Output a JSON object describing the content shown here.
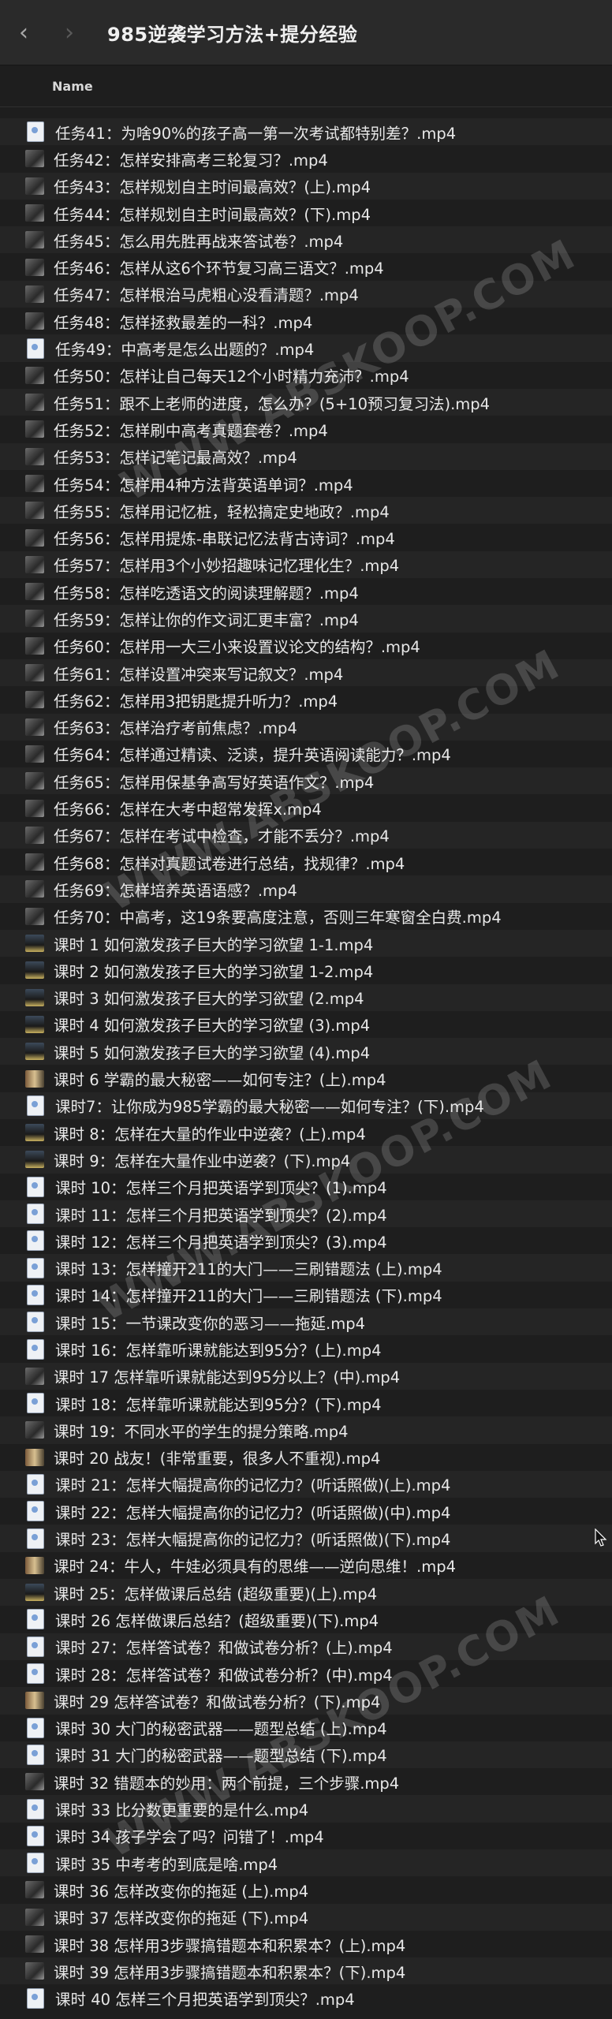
{
  "window": {
    "back_icon": "chevron-left-icon",
    "forward_icon": "chevron-right-icon",
    "title": "985逆袭学习方法+提分经验"
  },
  "list": {
    "column_header": "Name",
    "files": [
      {
        "name": "任务41：为啥90%的孩子高一第一次考试都特别差？.mp4",
        "thumb": "doc"
      },
      {
        "name": "任务42：怎样安排高考三轮复习？.mp4",
        "thumb": "img"
      },
      {
        "name": "任务43：怎样规划自主时间最高效？(上).mp4",
        "thumb": "img"
      },
      {
        "name": "任务44：怎样规划自主时间最高效？(下).mp4",
        "thumb": "img"
      },
      {
        "name": "任务45：怎么用先胜再战来答试卷？.mp4",
        "thumb": "img"
      },
      {
        "name": "任务46：怎样从这6个环节复习高三语文？.mp4",
        "thumb": "img"
      },
      {
        "name": "任务47：怎样根治马虎粗心没看清题？.mp4",
        "thumb": "img"
      },
      {
        "name": "任务48：怎样拯救最差的一科？.mp4",
        "thumb": "img"
      },
      {
        "name": "任务49：中高考是怎么出题的？.mp4",
        "thumb": "doc"
      },
      {
        "name": "任务50：怎样让自己每天12个小时精力充沛？.mp4",
        "thumb": "img"
      },
      {
        "name": "任务51：跟不上老师的进度，怎么办？(5+10预习复习法).mp4",
        "thumb": "img"
      },
      {
        "name": "任务52：怎样刷中高考真题套卷？.mp4",
        "thumb": "img"
      },
      {
        "name": "任务53：怎样记笔记最高效？.mp4",
        "thumb": "img"
      },
      {
        "name": "任务54：怎样用4种方法背英语单词？.mp4",
        "thumb": "img"
      },
      {
        "name": "任务55：怎样用记忆桩，轻松搞定史地政？.mp4",
        "thumb": "img"
      },
      {
        "name": "任务56：怎样用提炼-串联记忆法背古诗词？.mp4",
        "thumb": "img"
      },
      {
        "name": "任务57：怎样用3个小妙招趣味记忆理化生？.mp4",
        "thumb": "img"
      },
      {
        "name": "任务58：怎样吃透语文的阅读理解题？.mp4",
        "thumb": "img"
      },
      {
        "name": "任务59：怎样让你的作文词汇更丰富？.mp4",
        "thumb": "img"
      },
      {
        "name": "任务60：怎样用一大三小来设置议论文的结构？.mp4",
        "thumb": "img"
      },
      {
        "name": "任务61：怎样设置冲突来写记叙文？.mp4",
        "thumb": "img"
      },
      {
        "name": "任务62：怎样用3把钥匙提升听力？.mp4",
        "thumb": "img"
      },
      {
        "name": "任务63：怎样治疗考前焦虑？.mp4",
        "thumb": "img"
      },
      {
        "name": "任务64：怎样通过精读、泛读，提升英语阅读能力？.mp4",
        "thumb": "img"
      },
      {
        "name": "任务65：怎样用保基争高写好英语作文？.mp4",
        "thumb": "img"
      },
      {
        "name": "任务66：怎样在大考中超常发挥x.mp4",
        "thumb": "img"
      },
      {
        "name": "任务67：怎样在考试中检查，才能不丢分？.mp4",
        "thumb": "img"
      },
      {
        "name": "任务68：怎样对真题试卷进行总结，找规律？.mp4",
        "thumb": "img"
      },
      {
        "name": "任务69：怎样培养英语语感？.mp4",
        "thumb": "img"
      },
      {
        "name": "任务70：中高考，这19条要高度注意，否则三年寒窗全白费.mp4",
        "thumb": "img"
      },
      {
        "name": "课时 1 如何激发孩子巨大的学习欲望 1-1.mp4",
        "thumb": "img2"
      },
      {
        "name": "课时 2 如何激发孩子巨大的学习欲望 1-2.mp4",
        "thumb": "img2"
      },
      {
        "name": "课时 3 如何激发孩子巨大的学习欲望 (2.mp4",
        "thumb": "img2"
      },
      {
        "name": "课时 4 如何激发孩子巨大的学习欲望 (3).mp4",
        "thumb": "img2"
      },
      {
        "name": "课时 5 如何激发孩子巨大的学习欲望 (4).mp4",
        "thumb": "img2"
      },
      {
        "name": "课时 6 学霸的最大秘密——如何专注？(上).mp4",
        "thumb": "img3"
      },
      {
        "name": "课时7：让你成为985学霸的最大秘密——如何专注？(下).mp4",
        "thumb": "doc"
      },
      {
        "name": "课时 8：怎样在大量的作业中逆袭？(上).mp4",
        "thumb": "img2"
      },
      {
        "name": "课时 9：怎样在大量作业中逆袭？(下).mp4",
        "thumb": "img2"
      },
      {
        "name": "课时 10：怎样三个月把英语学到顶尖？(1).mp4",
        "thumb": "doc"
      },
      {
        "name": "课时 11：怎样三个月把英语学到顶尖？(2).mp4",
        "thumb": "doc"
      },
      {
        "name": "课时 12：怎样三个月把英语学到顶尖？(3).mp4",
        "thumb": "doc"
      },
      {
        "name": "课时 13：怎样撞开211的大门——三刷错题法 (上).mp4",
        "thumb": "doc"
      },
      {
        "name": "课时 14：怎样撞开211的大门——三刷错题法 (下).mp4",
        "thumb": "doc"
      },
      {
        "name": "课时 15：一节课改变你的恶习——拖延.mp4",
        "thumb": "doc"
      },
      {
        "name": "课时 16：怎样靠听课就能达到95分？(上).mp4",
        "thumb": "doc"
      },
      {
        "name": "课时 17 怎样靠听课就能达到95分以上？(中).mp4",
        "thumb": "img"
      },
      {
        "name": "课时 18：怎样靠听课就能达到95分？(下).mp4",
        "thumb": "doc"
      },
      {
        "name": "课时 19：不同水平的学生的提分策略.mp4",
        "thumb": "img"
      },
      {
        "name": "课时 20 战友！(非常重要，很多人不重视).mp4",
        "thumb": "img3"
      },
      {
        "name": "课时 21：怎样大幅提高你的记忆力？(听话照做)(上).mp4",
        "thumb": "doc"
      },
      {
        "name": "课时 22：怎样大幅提高你的记忆力？(听话照做)(中).mp4",
        "thumb": "doc"
      },
      {
        "name": "课时 23：怎样大幅提高你的记忆力？(听话照做)(下).mp4",
        "thumb": "doc"
      },
      {
        "name": "课时 24：牛人，牛娃必须具有的思维——逆向思维！.mp4",
        "thumb": "img3"
      },
      {
        "name": "课时 25：怎样做课后总结 (超级重要)(上).mp4",
        "thumb": "img2"
      },
      {
        "name": "课时 26 怎样做课后总结？(超级重要)(下).mp4",
        "thumb": "doc"
      },
      {
        "name": "课时 27：怎样答试卷？和做试卷分析？(上).mp4",
        "thumb": "doc"
      },
      {
        "name": "课时 28：怎样答试卷？和做试卷分析？(中).mp4",
        "thumb": "doc"
      },
      {
        "name": "课时 29 怎样答试卷？和做试卷分析？(下).mp4",
        "thumb": "img3"
      },
      {
        "name": "课时 30 大门的秘密武器——题型总结 (上).mp4",
        "thumb": "doc"
      },
      {
        "name": "课时 31 大门的秘密武器——题型总结 (下).mp4",
        "thumb": "doc"
      },
      {
        "name": "课时 32 错题本的妙用：两个前提，三个步骤.mp4",
        "thumb": "img"
      },
      {
        "name": "课时 33 比分数更重要的是什么.mp4",
        "thumb": "doc"
      },
      {
        "name": "课时 34 孩子学会了吗？问错了！.mp4",
        "thumb": "doc"
      },
      {
        "name": "课时 35 中考考的到底是啥.mp4",
        "thumb": "doc"
      },
      {
        "name": "课时 36 怎样改变你的拖延 (上).mp4",
        "thumb": "img"
      },
      {
        "name": "课时 37 怎样改变你的拖延 (下).mp4",
        "thumb": "img"
      },
      {
        "name": "课时 38 怎样用3步骤搞错题本和积累本？(上).mp4",
        "thumb": "img"
      },
      {
        "name": "课时 39 怎样用3步骤搞错题本和积累本？(下).mp4",
        "thumb": "img"
      },
      {
        "name": "课时 40 怎样三个月把英语学到顶尖？.mp4",
        "thumb": "doc"
      }
    ]
  },
  "watermark_text": "WWW.ABSKOOP.COM"
}
